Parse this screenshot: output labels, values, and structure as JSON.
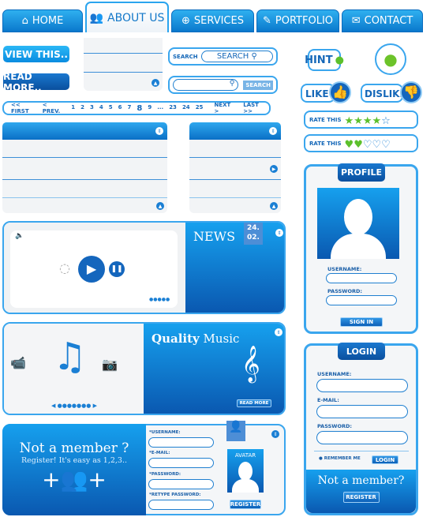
{
  "nav": {
    "tabs": [
      {
        "label": "HOME",
        "icon": "home-icon"
      },
      {
        "label": "ABOUT US",
        "icon": "users-icon",
        "active": true
      },
      {
        "label": "SERVICES",
        "icon": "globe-icon"
      },
      {
        "label": "PORTFOLIO",
        "icon": "pencil-icon"
      },
      {
        "label": "CONTACT",
        "icon": "mail-icon"
      }
    ]
  },
  "buttons": {
    "view_this": "VIEW THIS..",
    "read_more": "READ MORE.."
  },
  "search1": {
    "label": "SEARCH",
    "placeholder": "SEARCH"
  },
  "search2": {
    "button": "SEARCH",
    "placeholder": ""
  },
  "hint": "HINT",
  "like": "LIKE",
  "dislike": "DISLIKE",
  "pagination": {
    "first": "<< FIRST",
    "prev": "< PREV.",
    "pages": [
      "1",
      "2",
      "3",
      "4",
      "5",
      "6",
      "7",
      "8",
      "9",
      "...",
      "23",
      "24",
      "25"
    ],
    "current": "8",
    "next": "NEXT >",
    "last": "LAST >>"
  },
  "rating": [
    {
      "label": "RATE THIS",
      "value": 4,
      "max": 5,
      "shape": "star"
    },
    {
      "label": "RATE THIS",
      "value": 2,
      "max": 5,
      "shape": "heart"
    }
  ],
  "profile": {
    "title": "PROFILE",
    "username_label": "USERNAME:",
    "password_label": "PASSWORD:",
    "signin": "SIGN IN"
  },
  "news": {
    "title": "NEWS",
    "date_day": "24.",
    "date_month": "02."
  },
  "music": {
    "title_bold": "Quality",
    "title_rest": " Music",
    "read_more": "READ MORE"
  },
  "login": {
    "title": "LOGIN",
    "username_label": "USERNAME:",
    "email_label": "E-MAIL:",
    "password_label": "PASSWORD:",
    "remember": "REMEMBER ME",
    "login_button": "LOGIN",
    "not_member": "Not a member?",
    "register": "REGISTER"
  },
  "register": {
    "headline": "Not a member ?",
    "sub": "Register! It's easy as 1,2,3..",
    "username_label": "*USERNAME:",
    "email_label": "*E-MAIL:",
    "password_label": "*PASSWORD:",
    "retype_label": "*RETYPE PASSWORD:",
    "avatar": "AVATAR",
    "button": "REGISTER"
  },
  "colors": {
    "primary": "#0a78cc",
    "light": "#2fb0f0",
    "green": "#5cc02c"
  }
}
